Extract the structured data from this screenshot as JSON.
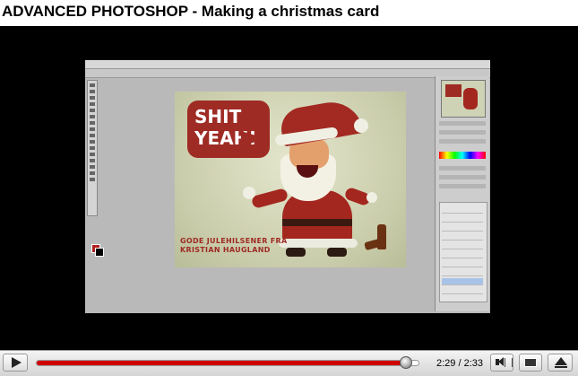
{
  "page": {
    "title": "ADVANCED PHOTOSHOP - Making a christmas card"
  },
  "video": {
    "card_bubble_text": "SHIT\nYEAH!",
    "card_greeting": "GODE JULEHILSENER FRA\nKRISTIAN HAUGLAND"
  },
  "player": {
    "current_time": "2:29",
    "duration": "2:33",
    "time_display": "2:29 / 2:33",
    "progress_fraction": 0.973,
    "accent_color": "#d10000"
  },
  "icons": {
    "play": "play-icon",
    "volume": "volume-icon",
    "size": "player-size-icon",
    "fullscreen": "fullscreen-icon"
  }
}
